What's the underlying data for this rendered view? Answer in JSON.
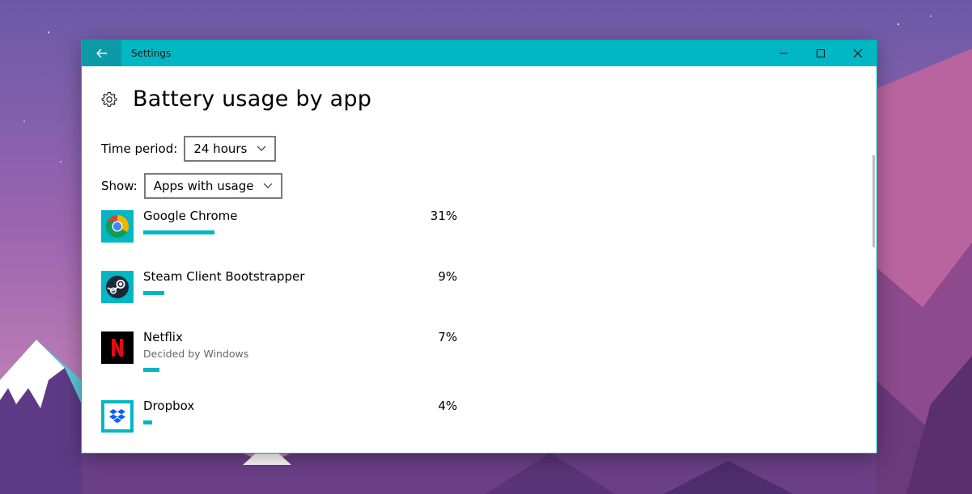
{
  "window": {
    "title": "Settings"
  },
  "page": {
    "title": "Battery usage by app"
  },
  "filters": {
    "time_period_label": "Time period:",
    "time_period_value": "24 hours",
    "show_label": "Show:",
    "show_value": "Apps with usage"
  },
  "apps": [
    {
      "name": "Google Chrome",
      "subtitle": "",
      "percent_label": "31%",
      "percent": 31,
      "icon": "chrome-icon"
    },
    {
      "name": "Steam Client Bootstrapper",
      "subtitle": "",
      "percent_label": "9%",
      "percent": 9,
      "icon": "steam-icon"
    },
    {
      "name": "Netflix",
      "subtitle": "Decided by Windows",
      "percent_label": "7%",
      "percent": 7,
      "icon": "netflix-icon"
    },
    {
      "name": "Dropbox",
      "subtitle": "",
      "percent_label": "4%",
      "percent": 4,
      "icon": "dropbox-icon"
    }
  ],
  "colors": {
    "accent": "#00b7c3",
    "titlebar_back": "#0b9aa6",
    "netflix_red": "#e50914",
    "icon_tile": "#00b7c3"
  }
}
